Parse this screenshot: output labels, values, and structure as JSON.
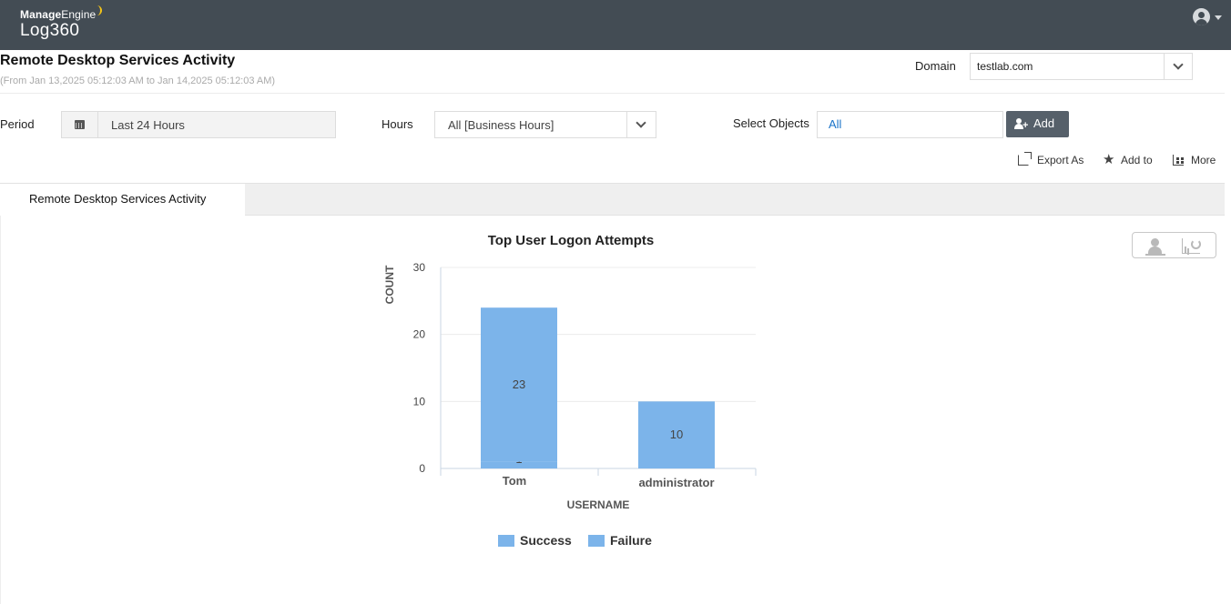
{
  "header": {
    "brand_me_bold": "Manage",
    "brand_me_regular": "Engine",
    "product": "Log360"
  },
  "report": {
    "title": "Remote Desktop Services Activity",
    "range": "(From Jan 13,2025 05:12:03 AM to Jan 14,2025 05:12:03 AM)"
  },
  "filters": {
    "domain_label": "Domain",
    "domain_value": "testlab.com",
    "period_label": "Period",
    "period_value": "Last 24 Hours",
    "hours_label": "Hours",
    "hours_value": "All [Business Hours]",
    "objects_label": "Select Objects",
    "objects_value": "All",
    "add_label": "Add"
  },
  "actions": {
    "export": "Export As",
    "add_to": "Add to",
    "more": "More"
  },
  "tabs": [
    {
      "label": "Remote Desktop Services Activity"
    }
  ],
  "colors": {
    "header_bg": "#434c54",
    "bar_color": "#7cb4ea"
  },
  "chart_data": {
    "type": "bar",
    "stacked": true,
    "title": "Top User Logon Attempts",
    "xlabel": "USERNAME",
    "ylabel": "COUNT",
    "ylim": [
      0,
      30
    ],
    "yticks": [
      0,
      10,
      20,
      30
    ],
    "categories": [
      "Tom",
      "administrator"
    ],
    "series": [
      {
        "name": "Success",
        "values": [
          1,
          10
        ],
        "labels": [
          "1",
          "10"
        ]
      },
      {
        "name": "Failure",
        "values": [
          23,
          0
        ],
        "labels": [
          "23",
          ""
        ]
      }
    ],
    "legend": [
      "Success",
      "Failure"
    ],
    "legend_position": "bottom",
    "grid": true
  }
}
